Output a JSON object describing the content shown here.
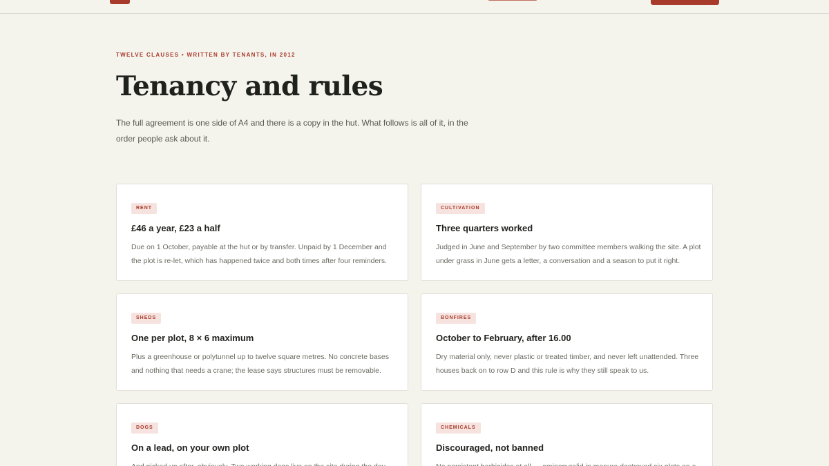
{
  "header": {
    "brand_colour": "#a83a2b"
  },
  "intro": {
    "eyebrow": "Twelve clauses • written by tenants, in 2012",
    "title": "Tenancy and rules",
    "lede": "The full agreement is one side of A4 and there is a copy in the hut. What follows is all of it, in the order people ask about it."
  },
  "rules": [
    {
      "tag": "Rent",
      "title": "£46 a year, £23 a half",
      "body": "Due on 1 October, payable at the hut or by transfer. Unpaid by 1 December and the plot is re-let, which has happened twice and both times after four reminders."
    },
    {
      "tag": "Cultivation",
      "title": "Three quarters worked",
      "body": "Judged in June and September by two committee members walking the site. A plot under grass in June gets a letter, a conversation and a season to put it right."
    },
    {
      "tag": "Sheds",
      "title": "One per plot, 8 × 6 maximum",
      "body": "Plus a greenhouse or polytunnel up to twelve square metres. No concrete bases and nothing that needs a crane; the lease says structures must be removable."
    },
    {
      "tag": "Bonfires",
      "title": "October to February, after 16.00",
      "body": "Dry material only, never plastic or treated timber, and never left unattended. Three houses back on to row D and this rule is why they still speak to us."
    },
    {
      "tag": "Dogs",
      "title": "On a lead, on your own plot",
      "body": "And picked up after, obviously. Two working dogs live on the site during the day"
    },
    {
      "tag": "Chemicals",
      "title": "Discouraged, not banned",
      "body": "No persistent herbicides at all — aminopyralid in manure destroyed six plots on a"
    }
  ]
}
